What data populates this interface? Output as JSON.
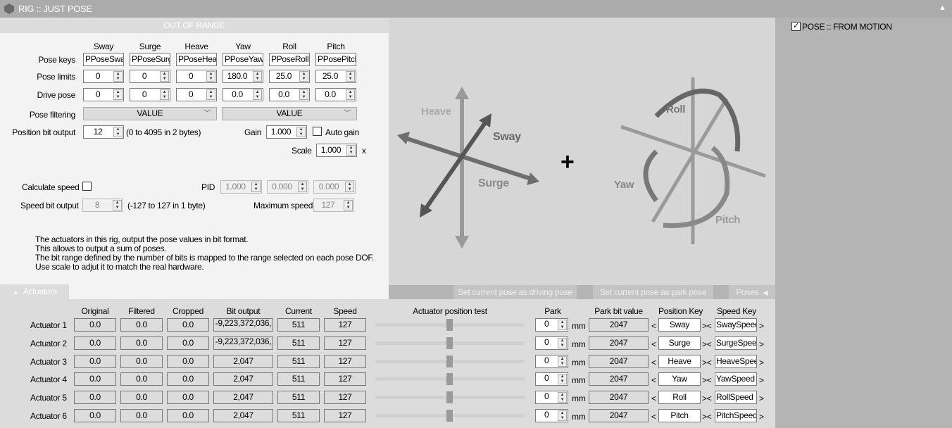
{
  "window": {
    "title": "RIG :: JUST POSE",
    "collapse_icon": "triangle-up-icon"
  },
  "status": {
    "out_of_range": "OUT OF RANGE"
  },
  "pose": {
    "columns": [
      "Sway",
      "Surge",
      "Heave",
      "Yaw",
      "Roll",
      "Pitch"
    ],
    "row_labels": {
      "keys": "Pose keys",
      "limits": "Pose limits",
      "drive": "Drive pose",
      "filtering": "Pose filtering",
      "bit_output": "Position bit output"
    },
    "keys": [
      "PPoseSway",
      "PPoseSurge",
      "PPoseHeave",
      "PPoseYaw",
      "PPoseRoll",
      "PPosePitch"
    ],
    "limits": [
      "0",
      "0",
      "0",
      "180.0",
      "25.0",
      "25.0"
    ],
    "drive": [
      "0",
      "0",
      "0",
      "0.0",
      "0.0",
      "0.0"
    ],
    "filtering": [
      "VALUE",
      "VALUE"
    ],
    "bit_output": "12",
    "bit_output_note": "(0 to 4095 in 2 bytes)",
    "gain_label": "Gain",
    "gain": "1.000",
    "auto_gain_label": "Auto gain",
    "auto_gain": false,
    "scale_label": "Scale",
    "scale": "1.000",
    "scale_unit": "x"
  },
  "speed": {
    "calc_label": "Calculate speed",
    "calc": false,
    "pid_label": "PID",
    "pid": [
      "1.000",
      "0.000",
      "0.000"
    ],
    "bit_label": "Speed bit output",
    "bit": "8",
    "bit_note": "(-127 to 127 in 1 byte)",
    "max_label": "Maximum speed",
    "max": "127"
  },
  "notes": [
    "The actuators in this rig, output the pose values in bit format.",
    "This allows to output a sum of poses.",
    "The bit range defined by the number of bits is mapped to the range selected on each pose DOF.",
    "Use scale to adjut it to match the real hardware."
  ],
  "diagram": {
    "heave": "Heave",
    "sway": "Sway",
    "surge": "Surge",
    "plus": "+",
    "roll": "Roll",
    "yaw": "Yaw",
    "pitch": "Pitch"
  },
  "right_panel": {
    "pose_from_motion": "POSE :: FROM MOTION",
    "checked": true
  },
  "toolbar": {
    "actuators_tab": "Actuators",
    "set_driving": "Set current pose as driving pose",
    "set_park": "Set current pose as park pose",
    "poses": "Poses"
  },
  "actuators": {
    "headers": {
      "original": "Original",
      "filtered": "Filtered",
      "cropped": "Cropped",
      "bit": "Bit output",
      "current": "Current",
      "speed": "Speed",
      "test": "Actuator position test",
      "park": "Park",
      "park_bit": "Park bit value",
      "pos_key": "Position Key",
      "speed_key": "Speed Key"
    },
    "unit": "mm",
    "rows": [
      {
        "name": "Actuator 1",
        "original": "0.0",
        "filtered": "0.0",
        "cropped": "0.0",
        "bit": "-9,223,372,036,",
        "current": "511",
        "speed": "127",
        "test": 0.5,
        "park": "0",
        "park_bit": "2047",
        "pos_key": "Sway",
        "speed_key": "SwaySpeed"
      },
      {
        "name": "Actuator 2",
        "original": "0.0",
        "filtered": "0.0",
        "cropped": "0.0",
        "bit": "-9,223,372,036,",
        "current": "511",
        "speed": "127",
        "test": 0.5,
        "park": "0",
        "park_bit": "2047",
        "pos_key": "Surge",
        "speed_key": "SurgeSpeed"
      },
      {
        "name": "Actuator 3",
        "original": "0.0",
        "filtered": "0.0",
        "cropped": "0.0",
        "bit": "2,047",
        "current": "511",
        "speed": "127",
        "test": 0.5,
        "park": "0",
        "park_bit": "2047",
        "pos_key": "Heave",
        "speed_key": "HeaveSpeed"
      },
      {
        "name": "Actuator 4",
        "original": "0.0",
        "filtered": "0.0",
        "cropped": "0.0",
        "bit": "2,047",
        "current": "511",
        "speed": "127",
        "test": 0.5,
        "park": "0",
        "park_bit": "2047",
        "pos_key": "Yaw",
        "speed_key": "YawSpeed"
      },
      {
        "name": "Actuator 5",
        "original": "0.0",
        "filtered": "0.0",
        "cropped": "0.0",
        "bit": "2,047",
        "current": "511",
        "speed": "127",
        "test": 0.5,
        "park": "0",
        "park_bit": "2047",
        "pos_key": "Roll",
        "speed_key": "RollSpeed"
      },
      {
        "name": "Actuator 6",
        "original": "0.0",
        "filtered": "0.0",
        "cropped": "0.0",
        "bit": "2,047",
        "current": "511",
        "speed": "127",
        "test": 0.5,
        "park": "0",
        "park_bit": "2047",
        "pos_key": "Pitch",
        "speed_key": "PitchSpeed"
      }
    ]
  }
}
